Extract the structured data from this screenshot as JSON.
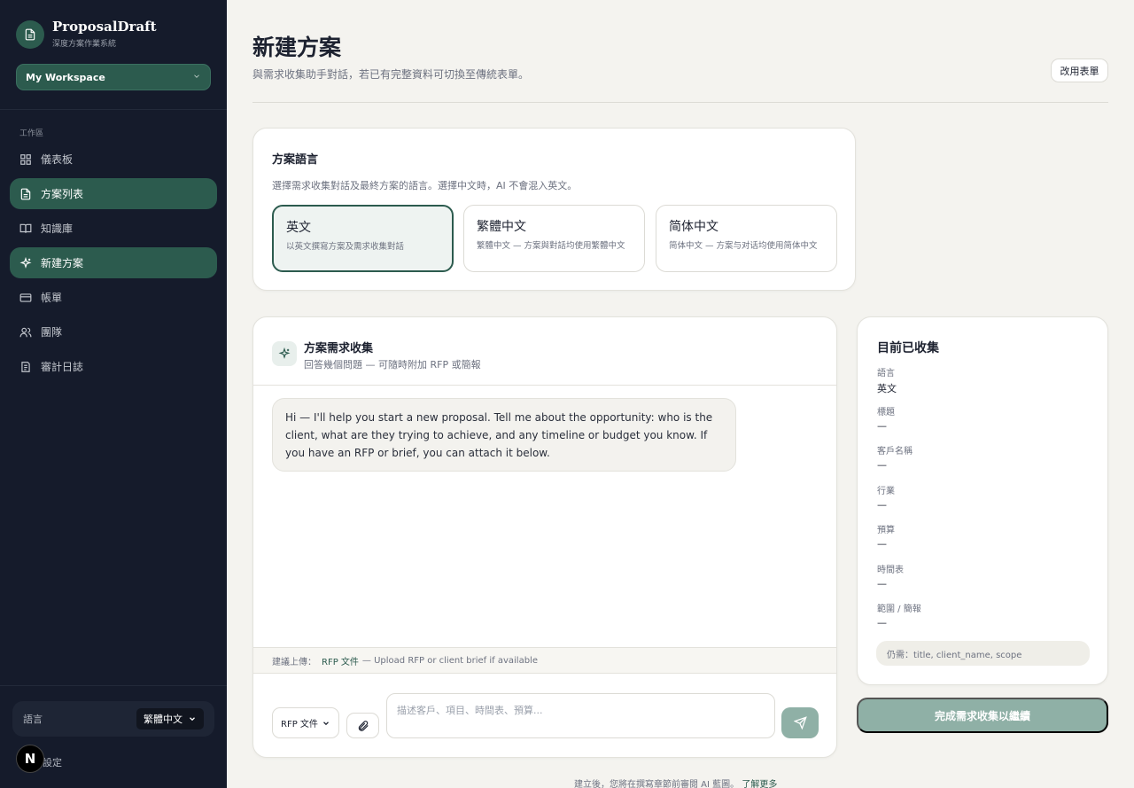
{
  "brand": {
    "name": "ProposalDraft",
    "subtitle": "深度方案作業系統"
  },
  "workspace": {
    "label": "My Workspace"
  },
  "sidebar": {
    "section_label": "工作區",
    "items": [
      {
        "label": "儀表板",
        "icon": "grid-icon",
        "active": false
      },
      {
        "label": "方案列表",
        "icon": "document-icon",
        "active": true
      },
      {
        "label": "知識庫",
        "icon": "book-icon",
        "active": false
      },
      {
        "label": "新建方案",
        "icon": "sparkle-icon",
        "active": true
      },
      {
        "label": "帳單",
        "icon": "card-icon",
        "active": false
      },
      {
        "label": "團隊",
        "icon": "users-icon",
        "active": false
      },
      {
        "label": "審計日誌",
        "icon": "log-icon",
        "active": false
      }
    ],
    "language_label": "語言",
    "language_value": "繁體中文",
    "settings_label": "設定",
    "n_badge": "N"
  },
  "header": {
    "title": "新建方案",
    "subtitle": "與需求收集助手對話，若已有完整資料可切換至傳統表單。",
    "use_form_button": "改用表單"
  },
  "language_card": {
    "title": "方案語言",
    "description": "選擇需求收集對話及最終方案的語言。選擇中文時，AI 不會混入英文。",
    "options": [
      {
        "title": "英文",
        "description": "以英文撰寫方案及需求收集對話",
        "selected": true
      },
      {
        "title": "繁體中文",
        "description": "繁體中文 — 方案與對話均使用繁體中文",
        "selected": false
      },
      {
        "title": "简体中文",
        "description": "简体中文 — 方案与对话均使用简体中文",
        "selected": false
      }
    ]
  },
  "chat": {
    "title": "方案需求收集",
    "subtitle": "回答幾個問題 — 可隨時附加 RFP 或簡報",
    "assistant_message": "Hi — I'll help you start a new proposal. Tell me about the opportunity: who is the client, what are they trying to achieve, and any timeline or budget you know. If you have an RFP or brief, you can attach it below.",
    "upload_hint_prefix": "建議上傳：",
    "upload_hint_highlight": "RFP 文件",
    "upload_hint_suffix": "— Upload RFP or client brief if available",
    "doc_type_select": "RFP 文件",
    "input_placeholder": "描述客戶、項目、時間表、預算..."
  },
  "collected": {
    "title": "目前已收集",
    "fields": [
      {
        "label": "語言",
        "value": "英文"
      },
      {
        "label": "標題",
        "value": "—"
      },
      {
        "label": "客戶名稱",
        "value": "—"
      },
      {
        "label": "行業",
        "value": "—"
      },
      {
        "label": "預算",
        "value": "—"
      },
      {
        "label": "時間表",
        "value": "—"
      },
      {
        "label": "範圍 / 簡報",
        "value": "—"
      }
    ],
    "missing": "仍需：title, client_name, scope"
  },
  "finish_button": "完成需求收集以繼續",
  "footer": {
    "note": "建立後，您將在撰寫章節前審閱 AI 藍圖。",
    "link": "了解更多"
  },
  "colors": {
    "accent": "#2c5b4e",
    "sidebar_bg": "#151b2b",
    "page_bg": "#f4f3ef",
    "disabled_button": "#8fb0a6"
  }
}
